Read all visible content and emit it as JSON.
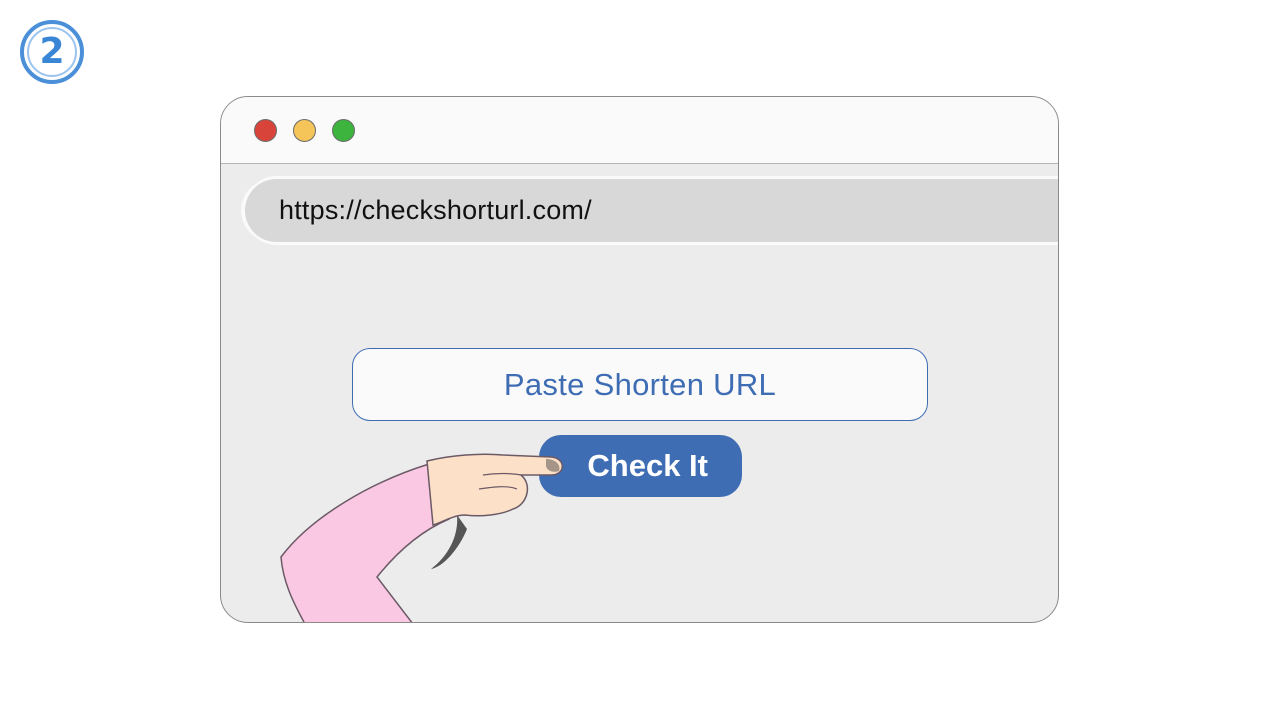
{
  "step": {
    "number": "2"
  },
  "window": {
    "controls": [
      "close",
      "minimize",
      "maximize"
    ],
    "colors": {
      "close": "#d8443a",
      "minimize": "#f6c55a",
      "maximize": "#3db43d"
    }
  },
  "addressbar": {
    "url": "https://checkshorturl.com/"
  },
  "form": {
    "input_placeholder": "Paste Shorten URL",
    "button_label": "Check It"
  },
  "colors": {
    "accent": "#3f6db4",
    "step_badge": "#3a86d6",
    "sleeve": "#fbc8e4",
    "skin": "#fde0c8"
  },
  "illustration": {
    "hand_icon": "pointing-hand-icon"
  }
}
